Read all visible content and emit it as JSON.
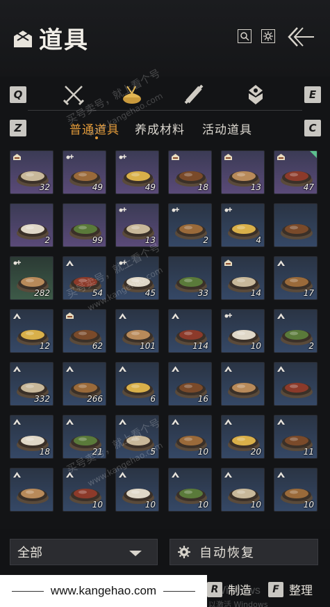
{
  "header": {
    "title": "道具",
    "buttons": [
      "search-icon",
      "settings-icon"
    ],
    "back_icon": "back-arrow-icon"
  },
  "categories": {
    "left_key": "Q",
    "right_key": "E",
    "icons": [
      "swords-icon",
      "food-icon",
      "scroll-icon",
      "gem-icon"
    ],
    "active_index": 1
  },
  "tabs": {
    "left_key": "Z",
    "right_key": "C",
    "items": [
      "普通道具",
      "养成材料",
      "活动道具"
    ],
    "active_index": 0
  },
  "items": [
    {
      "count": "32",
      "rarity": "purple",
      "badge": "house"
    },
    {
      "count": "49",
      "rarity": "purple",
      "badge": "drops"
    },
    {
      "count": "49",
      "rarity": "purple",
      "badge": "drops"
    },
    {
      "count": "18",
      "rarity": "purple",
      "badge": "house"
    },
    {
      "count": "13",
      "rarity": "purple",
      "badge": "house"
    },
    {
      "count": "47",
      "rarity": "purple",
      "badge": "house",
      "new": true
    },
    {
      "count": "2",
      "rarity": "purple",
      "badge": ""
    },
    {
      "count": "99",
      "rarity": "purple",
      "badge": ""
    },
    {
      "count": "13",
      "rarity": "purple",
      "badge": "drops"
    },
    {
      "count": "2",
      "rarity": "blue",
      "badge": "drops"
    },
    {
      "count": "4",
      "rarity": "blue",
      "badge": "drops"
    },
    {
      "count": "",
      "rarity": "blue",
      "badge": ""
    },
    {
      "count": "282",
      "rarity": "green",
      "badge": "drops"
    },
    {
      "count": "54",
      "rarity": "blue",
      "badge": "up"
    },
    {
      "count": "45",
      "rarity": "blue",
      "badge": "drops"
    },
    {
      "count": "33",
      "rarity": "blue",
      "badge": ""
    },
    {
      "count": "14",
      "rarity": "blue",
      "badge": "house"
    },
    {
      "count": "17",
      "rarity": "blue",
      "badge": "up"
    },
    {
      "count": "12",
      "rarity": "blue",
      "badge": "up"
    },
    {
      "count": "62",
      "rarity": "blue",
      "badge": "house"
    },
    {
      "count": "101",
      "rarity": "blue",
      "badge": "up"
    },
    {
      "count": "114",
      "rarity": "blue",
      "badge": "up"
    },
    {
      "count": "10",
      "rarity": "blue",
      "badge": "drops"
    },
    {
      "count": "2",
      "rarity": "blue",
      "badge": "up"
    },
    {
      "count": "332",
      "rarity": "blue",
      "badge": "up"
    },
    {
      "count": "266",
      "rarity": "blue",
      "badge": "up"
    },
    {
      "count": "6",
      "rarity": "blue",
      "badge": "up"
    },
    {
      "count": "16",
      "rarity": "blue",
      "badge": "up"
    },
    {
      "count": "",
      "rarity": "blue",
      "badge": "up"
    },
    {
      "count": "",
      "rarity": "blue",
      "badge": "up"
    },
    {
      "count": "18",
      "rarity": "blue",
      "badge": "up"
    },
    {
      "count": "21",
      "rarity": "blue",
      "badge": "up"
    },
    {
      "count": "5",
      "rarity": "blue",
      "badge": "up"
    },
    {
      "count": "10",
      "rarity": "blue",
      "badge": "up"
    },
    {
      "count": "20",
      "rarity": "blue",
      "badge": "up"
    },
    {
      "count": "11",
      "rarity": "blue",
      "badge": "up"
    },
    {
      "count": "",
      "rarity": "blue",
      "badge": "up"
    },
    {
      "count": "10",
      "rarity": "blue",
      "badge": "up"
    },
    {
      "count": "10",
      "rarity": "blue",
      "badge": "up"
    },
    {
      "count": "10",
      "rarity": "blue",
      "badge": "up"
    },
    {
      "count": "10",
      "rarity": "blue",
      "badge": "up"
    },
    {
      "count": "10",
      "rarity": "blue",
      "badge": "up"
    }
  ],
  "filter": {
    "selected": "全部"
  },
  "auto_recover": {
    "label": "自动恢复"
  },
  "actions": [
    {
      "key": "R",
      "label": "制造"
    },
    {
      "key": "F",
      "label": "整理"
    }
  ],
  "watermark": {
    "url": "www.kangehao.com",
    "site_text": "买号卖号，就上看个号",
    "overlay_url": "www.kangehao.com",
    "windows_text": "Windows",
    "windows_sub": "以激活 Windows"
  },
  "colors": {
    "accent": "#e29a3a",
    "background": "#131416",
    "keycap": "#c9c7c2"
  }
}
